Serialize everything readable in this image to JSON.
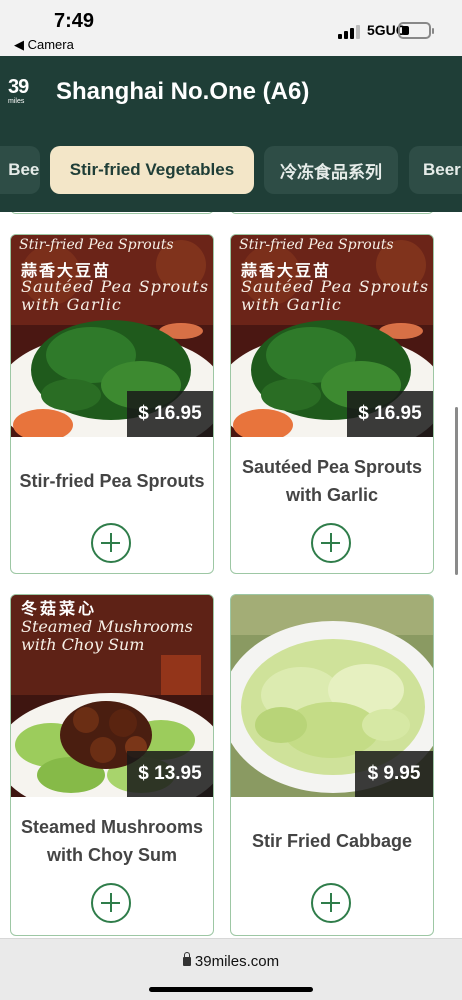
{
  "status_bar": {
    "time": "7:49",
    "back_app": "◀ Camera",
    "network": "5GUC"
  },
  "header": {
    "logo_number": "39",
    "logo_word": "miles",
    "title": "Shanghai No.One (A6)"
  },
  "tabs": [
    {
      "label": "Beer"
    },
    {
      "label": "Stir-fried Vegetables",
      "active": true
    },
    {
      "label": "冷冻食品系列"
    },
    {
      "label": "Beer"
    }
  ],
  "colors": {
    "header": "#1f3e37",
    "active_tab": "#f3e6c8",
    "accent_green": "#2f7d4a",
    "card_border": "#9dc7a4"
  },
  "menu_items": [
    {
      "name": "Stir-fried Pea Sprouts",
      "price": "$ 16.95",
      "photo_text": {
        "line1": "Stir-fried Pea Sprouts",
        "cn": "蒜香大豆苗",
        "en1": "Sautéed Pea Sprouts",
        "en2": "with Garlic"
      }
    },
    {
      "name": "Sautéed Pea Sprouts with Garlic",
      "price": "$ 16.95",
      "photo_text": {
        "line1": "Stir-fried Pea Sprouts",
        "cn": "蒜香大豆苗",
        "en1": "Sautéed Pea Sprouts",
        "en2": "with Garlic"
      }
    },
    {
      "name": "Steamed Mushrooms with Choy Sum",
      "price": "$ 13.95",
      "photo_text": {
        "cn": "冬菇菜心",
        "en1": "Steamed Mushrooms",
        "en2": "with Choy Sum"
      }
    },
    {
      "name": "Stir Fried Cabbage",
      "price": "$ 9.95"
    }
  ],
  "address_bar": {
    "url": "39miles.com"
  }
}
